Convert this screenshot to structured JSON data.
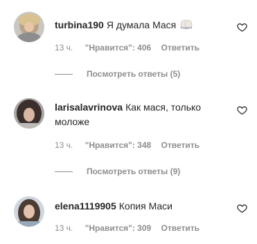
{
  "comments": [
    {
      "username": "turbina190",
      "text": "Я думала Мася",
      "emoji": "hands-emoji",
      "time": "13 ч.",
      "likes": "\"Нравится\": 406",
      "reply_label": "Ответить",
      "view_replies": "Посмотреть ответы (5)"
    },
    {
      "username": "larisalavrinova",
      "text": "Как мася, только моложе",
      "time": "13 ч.",
      "likes": "\"Нравится\": 348",
      "reply_label": "Ответить",
      "view_replies": "Посмотреть ответы (9)"
    },
    {
      "username": "elena1119905",
      "text": "Копия Маси",
      "time": "13 ч.",
      "likes": "\"Нравится\": 309",
      "reply_label": "Ответить"
    }
  ],
  "icons": {
    "like": "heart-outline-icon"
  },
  "colors": {
    "text": "#262626",
    "secondary": "#8e8e8e",
    "background": "#ffffff"
  }
}
